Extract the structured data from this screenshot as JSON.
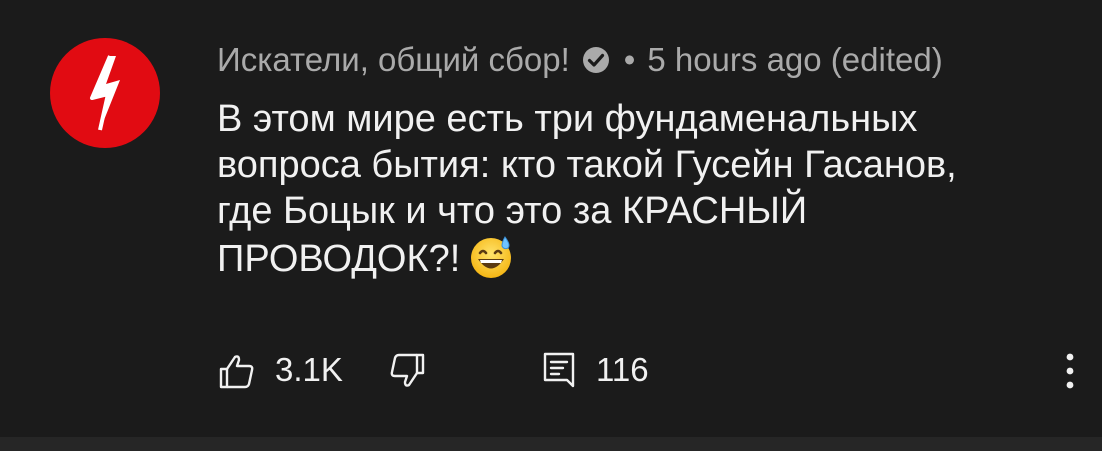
{
  "comment": {
    "author": "Искатели, общий сбор!",
    "verified_icon": "verified-check-icon",
    "separator": "•",
    "timestamp": "5 hours ago (edited)",
    "text": "В этом мире есть три фундаменальных\nвопроса бытия: кто такой Гусейн Гасанов,\nгде Боцык и что это за КРАСНЫЙ\nПРОВОДОК?!",
    "emoji": "grinning-face-with-sweat-emoji",
    "likes": "3.1K",
    "replies": "116"
  },
  "colors": {
    "background": "#1b1b1b",
    "avatar": "#e10b12",
    "meta_text": "#aaaaaa",
    "body_text": "#f1f1f1"
  }
}
